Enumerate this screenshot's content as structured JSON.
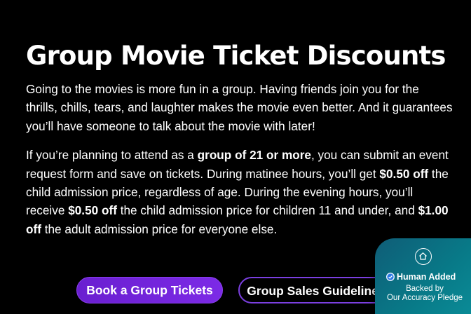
{
  "page": {
    "title": "Group Movie Ticket Discounts",
    "intro": "Going to the movies is more fun in a group. Having friends join you for the thrills, chills, tears, and laughter makes the movie even better. And it guarantees you’ll have someone to talk about the movie with later!",
    "details": {
      "t1": "If you’re planning to attend as a ",
      "b1": "group of 21 or more",
      "t2": ", you can submit an event request form and save on tickets. During matinee hours, you’ll get ",
      "b2": "$0.50 off",
      "t3": " the child admission price, regardless of age. During the evening hours, you’ll receive ",
      "b3": "$0.50 off",
      "t4": " the child admission price for children 11 and under, and ",
      "b4": "$1.00 off",
      "t5": " the adult admission price for everyone else."
    }
  },
  "buttons": {
    "book_label": "Book a Group Tickets",
    "guidelines_label": "Group Sales Guidelines"
  },
  "badge": {
    "status": "Human Added",
    "note_line1": "Backed by",
    "note_line2": "Our Accuracy Pledge",
    "icon": "shield-home-icon"
  },
  "colors": {
    "background": "#000000",
    "text": "#ffffff",
    "button_primary": "#7c2ae6",
    "button_border": "#7b3fe0",
    "badge": "#087a88"
  }
}
